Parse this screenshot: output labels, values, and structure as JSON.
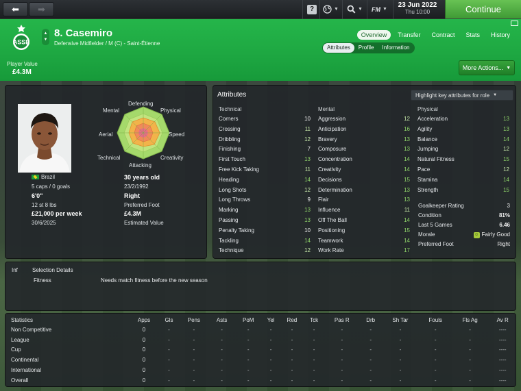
{
  "topbar": {
    "date": "23 Jun 2022",
    "day_time": "Thu 10:00",
    "help_label": "?",
    "fm_label": "FM",
    "continue_label": "Continue"
  },
  "header": {
    "player_name": "8. Casemiro",
    "role": "Defensive Midfielder / M (C) - Saint-Étienne",
    "tabs": [
      "Overview",
      "Transfer",
      "Contract",
      "Stats",
      "History"
    ],
    "active_tab": "Overview",
    "subtabs": [
      "Attributes",
      "Profile",
      "Information"
    ],
    "active_subtab": "Attributes",
    "value_label": "Player Value",
    "value": "£4.3M",
    "more_actions": "More Actions..."
  },
  "profile": {
    "radar_labels": {
      "defending": "Defending",
      "physical": "Physical",
      "speed": "Speed",
      "creativity": "Creativity",
      "attacking": "Attacking",
      "technical": "Technical",
      "aerial": "Aerial",
      "mental": "Mental"
    },
    "nationality": "Brazil",
    "caps": "5 caps / 0 goals",
    "age": "30 years old",
    "dob": "23/2/1992",
    "height": "6'0\"",
    "preferred_foot": "Right",
    "weight": "12 st 8 lbs",
    "preferred_foot_label": "Preferred Foot",
    "wage": "£21,000 per week",
    "estimated_value": "£4.3M",
    "contract_end": "30/6/2025",
    "estimated_value_label": "Estimated Value"
  },
  "attributes": {
    "title": "Attributes",
    "highlight_label": "Highlight key attributes for role",
    "technical_title": "Technical",
    "mental_title": "Mental",
    "physical_title": "Physical",
    "technical": [
      {
        "name": "Corners",
        "value": "10"
      },
      {
        "name": "Crossing",
        "value": "11"
      },
      {
        "name": "Dribbling",
        "value": "12"
      },
      {
        "name": "Finishing",
        "value": "7"
      },
      {
        "name": "First Touch",
        "value": "13"
      },
      {
        "name": "Free Kick Taking",
        "value": "11"
      },
      {
        "name": "Heading",
        "value": "14"
      },
      {
        "name": "Long Shots",
        "value": "12"
      },
      {
        "name": "Long Throws",
        "value": "9"
      },
      {
        "name": "Marking",
        "value": "13"
      },
      {
        "name": "Passing",
        "value": "13"
      },
      {
        "name": "Penalty Taking",
        "value": "10"
      },
      {
        "name": "Tackling",
        "value": "14"
      },
      {
        "name": "Technique",
        "value": "12"
      }
    ],
    "mental": [
      {
        "name": "Aggression",
        "value": "12"
      },
      {
        "name": "Anticipation",
        "value": "16"
      },
      {
        "name": "Bravery",
        "value": "13"
      },
      {
        "name": "Composure",
        "value": "13"
      },
      {
        "name": "Concentration",
        "value": "14"
      },
      {
        "name": "Creativity",
        "value": "14"
      },
      {
        "name": "Decisions",
        "value": "15"
      },
      {
        "name": "Determination",
        "value": "13"
      },
      {
        "name": "Flair",
        "value": "13"
      },
      {
        "name": "Influence",
        "value": "11"
      },
      {
        "name": "Off The Ball",
        "value": "14"
      },
      {
        "name": "Positioning",
        "value": "15"
      },
      {
        "name": "Teamwork",
        "value": "14"
      },
      {
        "name": "Work Rate",
        "value": "17"
      }
    ],
    "physical": [
      {
        "name": "Acceleration",
        "value": "13"
      },
      {
        "name": "Agility",
        "value": "13"
      },
      {
        "name": "Balance",
        "value": "14"
      },
      {
        "name": "Jumping",
        "value": "12"
      },
      {
        "name": "Natural Fitness",
        "value": "15"
      },
      {
        "name": "Pace",
        "value": "12"
      },
      {
        "name": "Stamina",
        "value": "14"
      },
      {
        "name": "Strength",
        "value": "15"
      }
    ],
    "other": [
      {
        "name": "Goalkeeper Rating",
        "value": "3"
      },
      {
        "name": "Condition",
        "value": "81%"
      },
      {
        "name": "Last 5 Games",
        "value": "6.46"
      },
      {
        "name": "Morale",
        "value": "Fairly Good"
      },
      {
        "name": "Preferred Foot",
        "value": "Right"
      }
    ]
  },
  "info": {
    "tab_inf": "Inf",
    "section_title": "Selection Details",
    "fitness_label": "Fitness",
    "fitness_text": "Needs match fitness before the new season"
  },
  "stats": {
    "title": "Statistics",
    "columns": [
      "Apps",
      "Gls",
      "Pens",
      "Asts",
      "PoM",
      "Yel",
      "Red",
      "Tck",
      "Pas R",
      "Drb",
      "Sh Tar",
      "Fouls",
      "Fls Ag",
      "Av R"
    ],
    "rows": [
      {
        "label": "Non Competitive",
        "apps": "0"
      },
      {
        "label": "League",
        "apps": "0"
      },
      {
        "label": "Cup",
        "apps": "0"
      },
      {
        "label": "Continental",
        "apps": "0"
      },
      {
        "label": "International",
        "apps": "0"
      },
      {
        "label": "Overall",
        "apps": "0"
      }
    ],
    "dash": "-",
    "rating_dash": "----"
  },
  "colors": {
    "header_green": "#1ea842",
    "continue_green": "#54b046",
    "attr_green": "#8fd46a"
  }
}
